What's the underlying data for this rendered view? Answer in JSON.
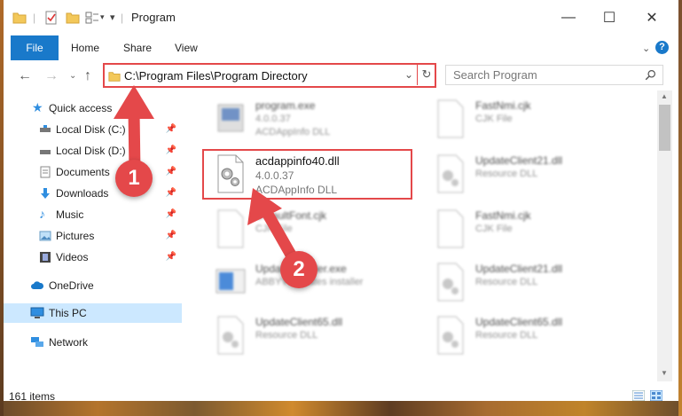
{
  "window": {
    "title": "Program",
    "minimize": "—",
    "maximize": "☐",
    "close": "✕"
  },
  "ribbon": {
    "tabs": [
      "File",
      "Home",
      "Share",
      "View"
    ],
    "help": "?"
  },
  "address": {
    "path": "C:\\Program Files\\Program Directory",
    "search_placeholder": "Search Program"
  },
  "nav": {
    "quick_access": "Quick access",
    "items": [
      {
        "label": "Local Disk (C:)",
        "pinned": true
      },
      {
        "label": "Local Disk (D:)",
        "pinned": true
      },
      {
        "label": "Documents",
        "pinned": true
      },
      {
        "label": "Downloads",
        "pinned": true
      },
      {
        "label": "Music",
        "pinned": true
      },
      {
        "label": "Pictures",
        "pinned": true
      },
      {
        "label": "Videos",
        "pinned": true
      }
    ],
    "onedrive": "OneDrive",
    "this_pc": "This PC",
    "network": "Network"
  },
  "files": {
    "left": [
      {
        "name": "program.exe",
        "line1": "4.0.0.37",
        "line2": "ACDAppInfo DLL"
      },
      {
        "name": "acdappinfo40.dll",
        "line1": "4.0.0.37",
        "line2": "ACDAppInfo DLL"
      },
      {
        "name": "DefaultFont.cjk",
        "line1": "CJK File",
        "line2": ""
      },
      {
        "name": "UpdateInstaller.exe",
        "line1": "ABBYY Updates installer",
        "line2": ""
      },
      {
        "name": "UpdateClient65.dll",
        "line1": "Resource DLL",
        "line2": ""
      }
    ],
    "right": [
      {
        "name": "FastNmi.cjk",
        "line1": "CJK File",
        "line2": ""
      },
      {
        "name": "UpdateClient21.dll",
        "line1": "Resource DLL",
        "line2": ""
      },
      {
        "name": "FastNmi.cjk",
        "line1": "CJK File",
        "line2": ""
      },
      {
        "name": "UpdateClient21.dll",
        "line1": "Resource DLL",
        "line2": ""
      },
      {
        "name": "UpdateClient65.dll",
        "line1": "Resource DLL",
        "line2": ""
      }
    ]
  },
  "status": {
    "count": "161 items"
  },
  "callouts": [
    "1",
    "2"
  ],
  "colors": {
    "accent": "#1979ca",
    "callout": "#e4484a",
    "selection": "#cce8ff"
  }
}
